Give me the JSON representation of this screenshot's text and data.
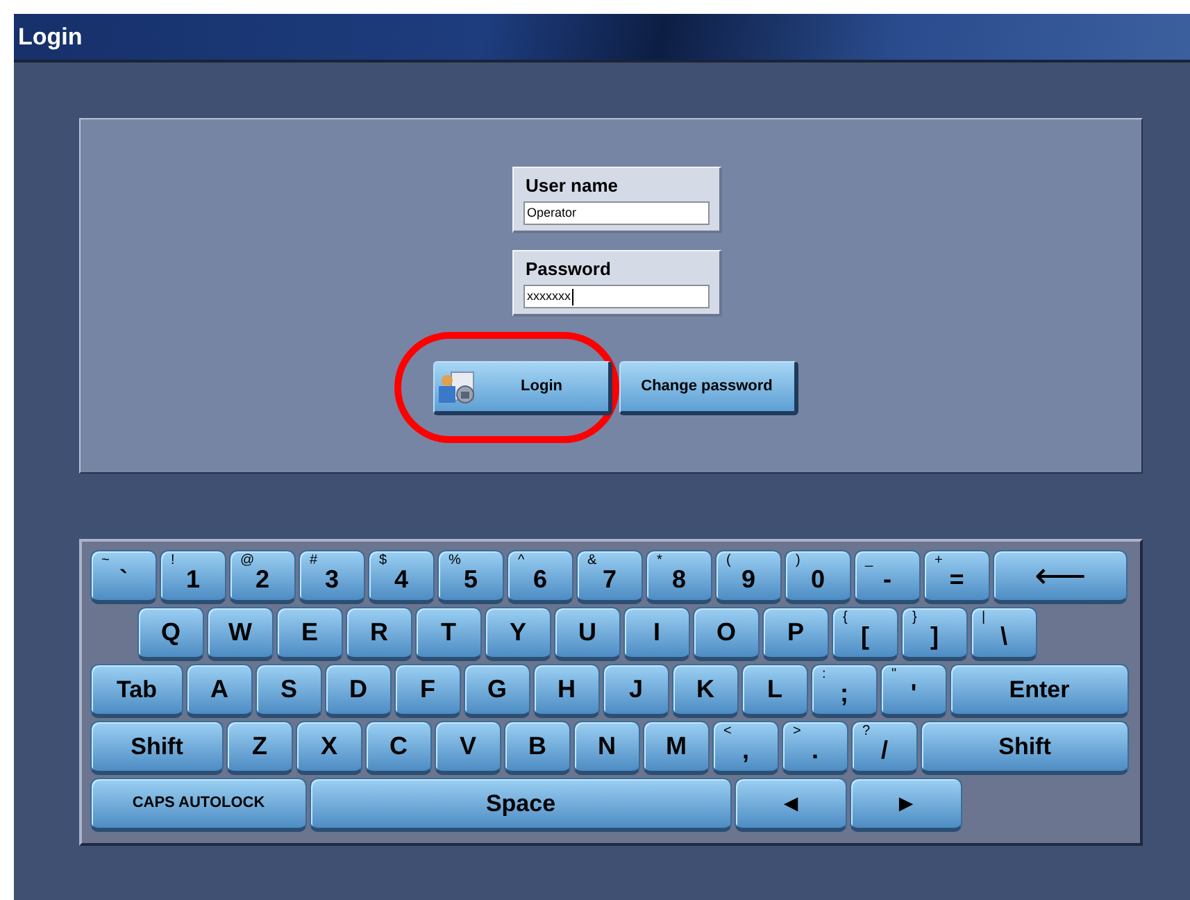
{
  "window": {
    "title": "Login"
  },
  "login_form": {
    "username": {
      "label": "User name",
      "value": "Operator",
      "focused": false
    },
    "password": {
      "label": "Password",
      "value": "xxxxxxx",
      "focused": true
    },
    "buttons": [
      {
        "kind": "login",
        "label": "Login",
        "highlighted": true
      },
      {
        "kind": "plain",
        "label": "Change password",
        "highlighted": false
      }
    ]
  },
  "keyboard": {
    "rows": [
      {
        "indent": false,
        "keys": [
          {
            "kind": "char",
            "shift": "~",
            "main": "`"
          },
          {
            "kind": "char",
            "shift": "!",
            "main": "1"
          },
          {
            "kind": "char",
            "shift": "@",
            "main": "2"
          },
          {
            "kind": "char",
            "shift": "#",
            "main": "3"
          },
          {
            "kind": "char",
            "shift": "$",
            "main": "4"
          },
          {
            "kind": "char",
            "shift": "%",
            "main": "5"
          },
          {
            "kind": "char",
            "shift": "^",
            "main": "6"
          },
          {
            "kind": "char",
            "shift": "&",
            "main": "7"
          },
          {
            "kind": "char",
            "shift": "*",
            "main": "8"
          },
          {
            "kind": "char",
            "shift": "(",
            "main": "9"
          },
          {
            "kind": "char",
            "shift": ")",
            "main": "0"
          },
          {
            "kind": "char",
            "shift": "_",
            "main": "-"
          },
          {
            "kind": "char",
            "shift": "+",
            "main": "="
          },
          {
            "kind": "backspace",
            "main": "⟵"
          }
        ]
      },
      {
        "indent": true,
        "keys": [
          {
            "kind": "char",
            "main": "Q"
          },
          {
            "kind": "char",
            "main": "W"
          },
          {
            "kind": "char",
            "main": "E"
          },
          {
            "kind": "char",
            "main": "R"
          },
          {
            "kind": "char",
            "main": "T"
          },
          {
            "kind": "char",
            "main": "Y"
          },
          {
            "kind": "char",
            "main": "U"
          },
          {
            "kind": "char",
            "main": "I"
          },
          {
            "kind": "char",
            "main": "O"
          },
          {
            "kind": "char",
            "main": "P"
          },
          {
            "kind": "char",
            "shift": "{",
            "main": "["
          },
          {
            "kind": "char",
            "shift": "}",
            "main": "]"
          },
          {
            "kind": "char",
            "shift": "|",
            "main": "\\"
          }
        ]
      },
      {
        "indent": false,
        "keys": [
          {
            "kind": "tab",
            "main": "Tab"
          },
          {
            "kind": "char",
            "main": "A"
          },
          {
            "kind": "char",
            "main": "S"
          },
          {
            "kind": "char",
            "main": "D"
          },
          {
            "kind": "char",
            "main": "F"
          },
          {
            "kind": "char",
            "main": "G"
          },
          {
            "kind": "char",
            "main": "H"
          },
          {
            "kind": "char",
            "main": "J"
          },
          {
            "kind": "char",
            "main": "K"
          },
          {
            "kind": "char",
            "main": "L"
          },
          {
            "kind": "char",
            "shift": ":",
            "main": ";"
          },
          {
            "kind": "char",
            "shift": "\"",
            "main": "'"
          },
          {
            "kind": "enter",
            "main": "Enter"
          }
        ]
      },
      {
        "indent": false,
        "keys": [
          {
            "kind": "shift",
            "main": "Shift"
          },
          {
            "kind": "char",
            "main": "Z"
          },
          {
            "kind": "char",
            "main": "X"
          },
          {
            "kind": "char",
            "main": "C"
          },
          {
            "kind": "char",
            "main": "V"
          },
          {
            "kind": "char",
            "main": "B"
          },
          {
            "kind": "char",
            "main": "N"
          },
          {
            "kind": "char",
            "main": "M"
          },
          {
            "kind": "char",
            "shift": "<",
            "main": ","
          },
          {
            "kind": "char",
            "shift": ">",
            "main": "."
          },
          {
            "kind": "char",
            "shift": "?",
            "main": "/"
          },
          {
            "kind": "rshift",
            "main": "Shift"
          }
        ]
      },
      {
        "indent": false,
        "keys": [
          {
            "kind": "caps",
            "main": "CAPS AUTOLOCK"
          },
          {
            "kind": "space",
            "main": "Space"
          },
          {
            "kind": "arrow",
            "main": "◄"
          },
          {
            "kind": "arrow",
            "main": "►"
          }
        ]
      }
    ]
  }
}
